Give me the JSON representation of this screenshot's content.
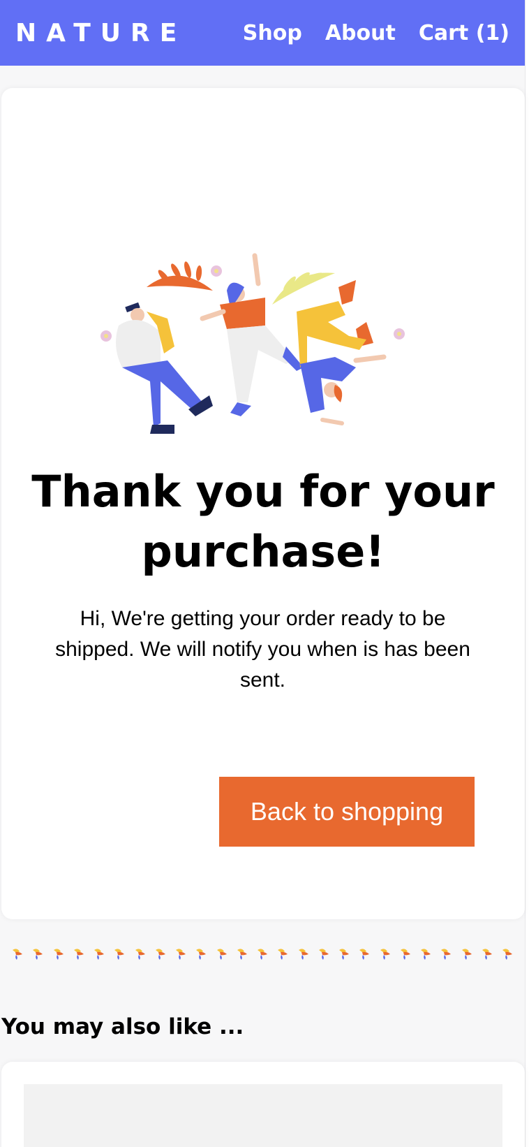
{
  "nav": {
    "brand": "NATURE",
    "links": [
      "Shop",
      "About",
      "Cart (1)"
    ]
  },
  "confirmation": {
    "illustration_icon": "dancing-people-illustration",
    "title": "Thank you for your purchase!",
    "message": "Hi, We're getting your order ready to be shipped. We will notify you when is has been sent.",
    "button_label": "Back to shopping"
  },
  "divider": {
    "icon": "bird-icon",
    "count": 25
  },
  "recommendations": {
    "heading": "You may also like ..."
  },
  "colors": {
    "nav_bg": "#616ff5",
    "accent": "#e8692f",
    "page_bg": "#f7f7f8"
  }
}
